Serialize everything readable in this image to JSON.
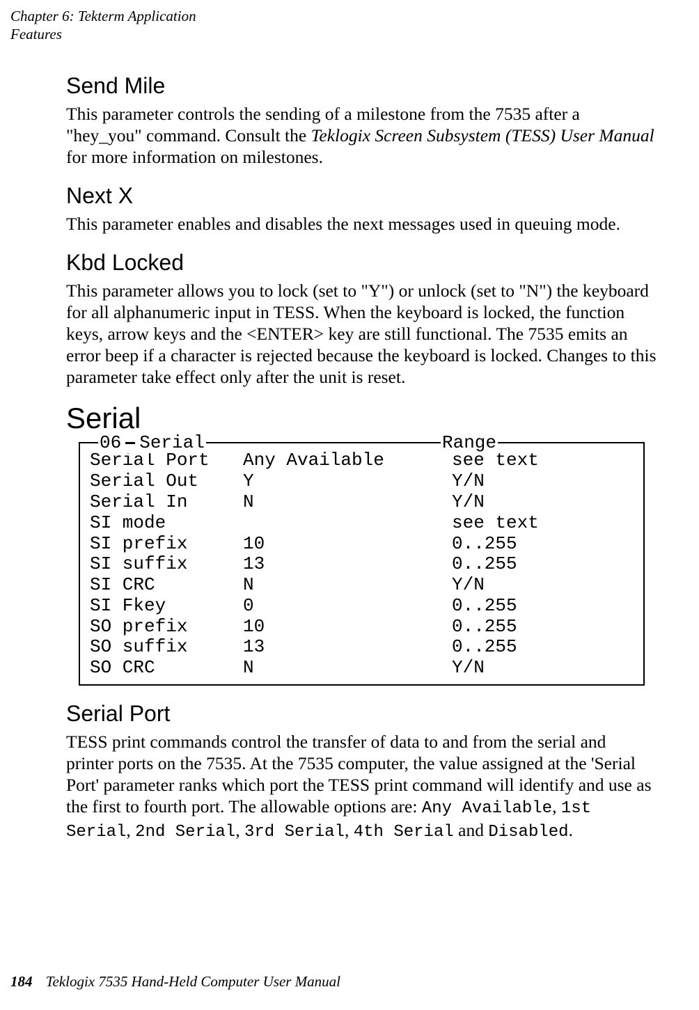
{
  "header": {
    "chapter_line": "Chapter  6:   Tekterm Application",
    "section_line": "Features"
  },
  "send_mile": {
    "heading": "Send Mile",
    "text_prefix": "This parameter controls the sending of a milestone from the 7535 after a \"hey_you\" command. Consult the ",
    "manual_ital": "Teklogix Screen Subsystem (TESS) User Manual",
    "text_suffix": " for more information on milestones."
  },
  "next_x": {
    "heading": "Next X",
    "text": "This parameter enables and disables the next messages used in queuing mode."
  },
  "kbd_locked": {
    "heading": "Kbd Locked",
    "text": "This parameter allows you to lock (set to \"Y\") or unlock (set to \"N\") the keyboard for all alphanumeric input in TESS. When the keyboard is locked, the function keys, arrow keys and the <ENTER> key are still functional. The 7535 emits an error beep if a character is rejected because the keyboard is locked. Changes to this parameter take effect only after the unit is reset."
  },
  "serial": {
    "heading": "Serial",
    "label_06": "06",
    "label_serial": "Serial",
    "label_range": "Range",
    "rows": [
      {
        "name": "Serial Port",
        "value": "Any Available",
        "range": "see text"
      },
      {
        "name": "Serial Out",
        "value": "Y",
        "range": "Y/N"
      },
      {
        "name": "Serial In",
        "value": "N",
        "range": "Y/N"
      },
      {
        "name": "SI mode",
        "value": "",
        "range": "see text"
      },
      {
        "name": "SI prefix",
        "value": "10",
        "range": "0..255"
      },
      {
        "name": "SI suffix",
        "value": "13",
        "range": "0..255"
      },
      {
        "name": "SI CRC",
        "value": "N",
        "range": "Y/N"
      },
      {
        "name": "SI Fkey",
        "value": "0",
        "range": "0..255"
      },
      {
        "name": "SO prefix",
        "value": "10",
        "range": "0..255"
      },
      {
        "name": "SO suffix",
        "value": "13",
        "range": "0..255"
      },
      {
        "name": "SO CRC",
        "value": "N",
        "range": "Y/N"
      }
    ]
  },
  "serial_port": {
    "heading": "Serial Port",
    "text_before_options": "TESS print commands control the transfer of data to and from the serial and printer ports on the 7535. At the 7535 computer, the value assigned at the 'Serial Port' parameter ranks which port the TESS print command will identify and use as the first to fourth port. The allowable options are: ",
    "opt1": "Any Available",
    "sep1": ", ",
    "opt2": "1st Serial",
    "sep2": ", ",
    "opt3": "2nd Serial",
    "sep3": ", ",
    "opt4": "3rd Serial",
    "sep4": ", ",
    "opt5": "4th Serial",
    "and_word": " and ",
    "opt6": "Disabled",
    "period": "."
  },
  "footer": {
    "page_number": "184",
    "manual_title": "Teklogix 7535 Hand-Held Computer User Manual"
  }
}
